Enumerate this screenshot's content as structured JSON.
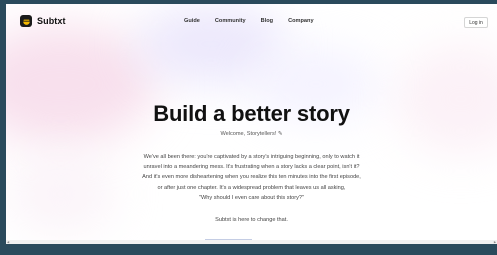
{
  "brand": {
    "name": "Subtxt"
  },
  "nav": {
    "links": [
      "Guide",
      "Community",
      "Blog",
      "Company"
    ],
    "login_label": "Log in"
  },
  "hero": {
    "title": "Build a better story",
    "welcome": "Welcome, Storytellers! ✎",
    "paragraph": [
      "We've all been there: you're captivated by a story's intriguing beginning, only to watch it",
      "unravel into a meandering mess. It's frustrating when a story lacks a clear point, isn't it?",
      "And it's even more disheartening when you realize this ten minutes into the first episode,",
      "or after just one chapter. It's a widespread problem that leaves us all asking,",
      "\"Why should I even care about this story?\""
    ],
    "tagline": "Subtxt is here to change that."
  },
  "colors": {
    "frame": "#2a4a5c",
    "logo_icon_bg": "#1b1b1b",
    "logo_icon_accent": "#f5b800",
    "text_dark": "#111111"
  }
}
